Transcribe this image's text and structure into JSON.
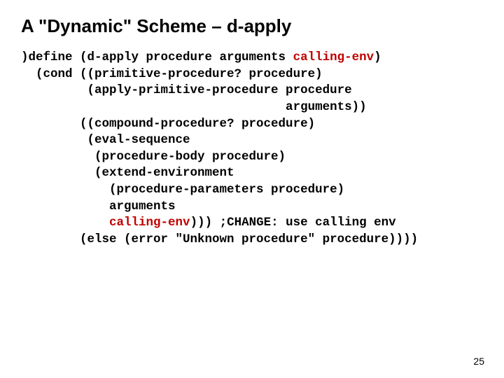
{
  "title": "A \"Dynamic\" Scheme – d-apply",
  "page_number": "25",
  "code": {
    "l1a": ")define (d-apply procedure arguments ",
    "l1b": "calling-env",
    "l1c": ")",
    "l2": "  (cond ((primitive-procedure? procedure)",
    "l3": "         (apply-primitive-procedure procedure",
    "l4": "                                    arguments))",
    "l5": "        ((compound-procedure? procedure)",
    "l6": "         (eval-sequence",
    "l7": "          (procedure-body procedure)",
    "l8": "          (extend-environment",
    "l9": "            (procedure-parameters procedure)",
    "l10": "            arguments",
    "l11a": "            ",
    "l11b": "calling-env",
    "l11c": "))) ;CHANGE: use calling env",
    "l12": "        (else (error \"Unknown procedure\" procedure))))"
  }
}
